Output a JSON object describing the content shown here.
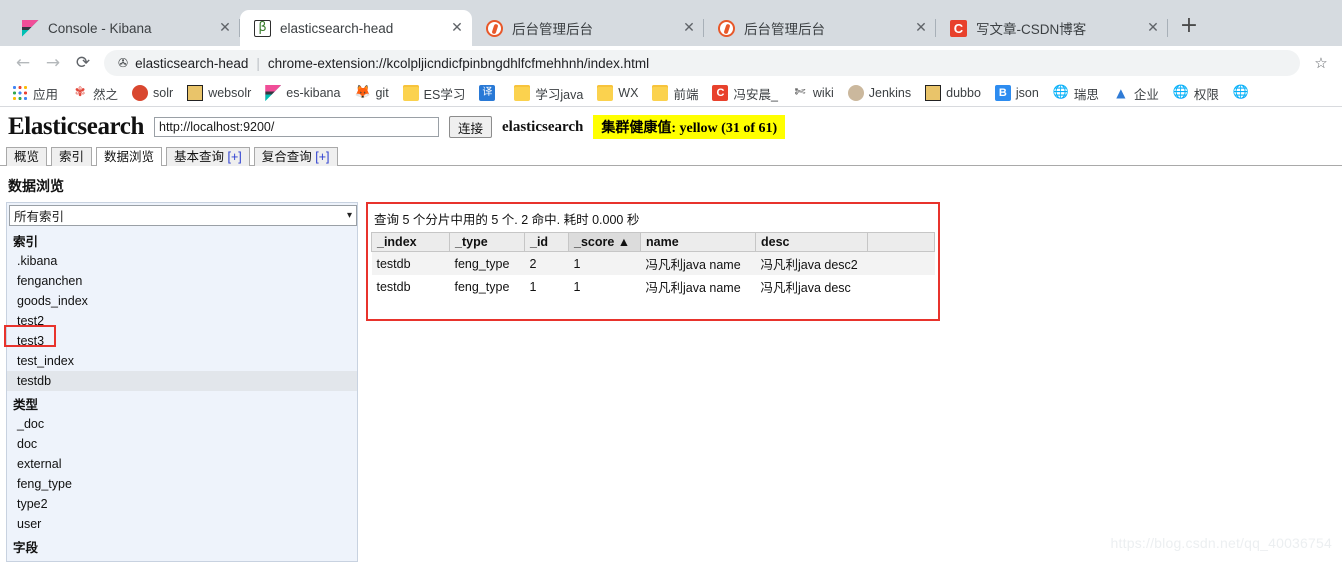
{
  "browser": {
    "tabs": [
      {
        "title": "Console - Kibana",
        "favicon": "kibana-icon",
        "active": false
      },
      {
        "title": "elasticsearch-head",
        "favicon": "head-icon",
        "active": true
      },
      {
        "title": "后台管理后台",
        "favicon": "admin-icon",
        "active": false
      },
      {
        "title": "后台管理后台",
        "favicon": "admin-icon",
        "active": false
      },
      {
        "title": "写文章-CSDN博客",
        "favicon": "csdn-icon",
        "active": false
      }
    ],
    "new_tab_label": "+",
    "close_label": "✕",
    "nav": {
      "back": "←",
      "forward": "→",
      "reload": "⟳"
    },
    "omnibox": {
      "extension_name": "elasticsearch-head",
      "separator": "|",
      "url": "chrome-extension://kcolpljicndicfpinbngdhlfcfmehhnh/index.html",
      "pin_icon": "extension-pin-icon",
      "star_icon": "bookmark-star-icon"
    },
    "bookmarks": [
      {
        "label": "应用",
        "icon": "apps-grid-icon"
      },
      {
        "label": "然之",
        "icon": "ranzhi-icon"
      },
      {
        "label": "solr",
        "icon": "solr-icon"
      },
      {
        "label": "websolr",
        "icon": "websolr-icon"
      },
      {
        "label": "es-kibana",
        "icon": "kibana-icon"
      },
      {
        "label": "git",
        "icon": "gitlab-icon"
      },
      {
        "label": "ES学习",
        "icon": "folder-icon"
      },
      {
        "label": "",
        "icon": "fanyi-icon"
      },
      {
        "label": "学习java",
        "icon": "folder-icon"
      },
      {
        "label": "WX",
        "icon": "folder-icon"
      },
      {
        "label": "前端",
        "icon": "folder-icon"
      },
      {
        "label": "冯安晨_",
        "icon": "csdn-icon"
      },
      {
        "label": "wiki",
        "icon": "wiki-icon"
      },
      {
        "label": "Jenkins",
        "icon": "jenkins-icon"
      },
      {
        "label": "dubbo",
        "icon": "dubbo-icon"
      },
      {
        "label": "json",
        "icon": "json-icon"
      },
      {
        "label": "瑞思",
        "icon": "globe-icon"
      },
      {
        "label": "企业",
        "icon": "enterprise-icon"
      },
      {
        "label": "权限",
        "icon": "globe-icon"
      },
      {
        "label": "",
        "icon": "globe-icon"
      }
    ]
  },
  "app": {
    "logo": "Elasticsearch",
    "connection_url": "http://localhost:9200/",
    "connection_placeholder": "http://localhost:9200/",
    "connect_button": "连接",
    "cluster_name": "elasticsearch",
    "cluster_health": "集群健康值: yellow (31 of 61)",
    "health_color": "#ffff00",
    "tabs": [
      {
        "label": "概览",
        "suffix": "",
        "active": false
      },
      {
        "label": "索引",
        "suffix": "",
        "active": false
      },
      {
        "label": "数据浏览",
        "suffix": "",
        "active": true
      },
      {
        "label": "基本查询 ",
        "suffix": "[+]",
        "active": false
      },
      {
        "label": "复合查询 ",
        "suffix": "[+]",
        "active": false
      }
    ],
    "section_title": "数据浏览"
  },
  "sidebar": {
    "index_select_value": "所有索引",
    "chevron": "▾",
    "index_group_title": "索引",
    "indices": [
      {
        "name": ".kibana",
        "selected": false
      },
      {
        "name": "fenganchen",
        "selected": false
      },
      {
        "name": "goods_index",
        "selected": false
      },
      {
        "name": "test2",
        "selected": false
      },
      {
        "name": "test3",
        "selected": false
      },
      {
        "name": "test_index",
        "selected": false
      },
      {
        "name": "testdb",
        "selected": true
      }
    ],
    "type_group_title": "类型",
    "types": [
      {
        "name": "_doc"
      },
      {
        "name": "doc"
      },
      {
        "name": "external"
      },
      {
        "name": "feng_type"
      },
      {
        "name": "type2"
      },
      {
        "name": "user"
      }
    ],
    "field_group_title": "字段"
  },
  "results": {
    "info": "查询 5 个分片中用的 5 个. 2 命中. 耗时 0.000 秒",
    "columns": [
      {
        "label": "_index",
        "sorted": false
      },
      {
        "label": "_type",
        "sorted": false
      },
      {
        "label": "_id",
        "sorted": false
      },
      {
        "label": "_score ▲",
        "sorted": true
      },
      {
        "label": "name",
        "sorted": false
      },
      {
        "label": "desc",
        "sorted": false
      },
      {
        "label": "",
        "sorted": false
      }
    ],
    "rows": [
      [
        "testdb",
        "feng_type",
        "2",
        "1",
        "冯凡利java name",
        "冯凡利java desc2",
        ""
      ],
      [
        "testdb",
        "feng_type",
        "1",
        "1",
        "冯凡利java name",
        "冯凡利java desc",
        ""
      ]
    ]
  },
  "watermark": "https://blog.csdn.net/qq_40036754"
}
